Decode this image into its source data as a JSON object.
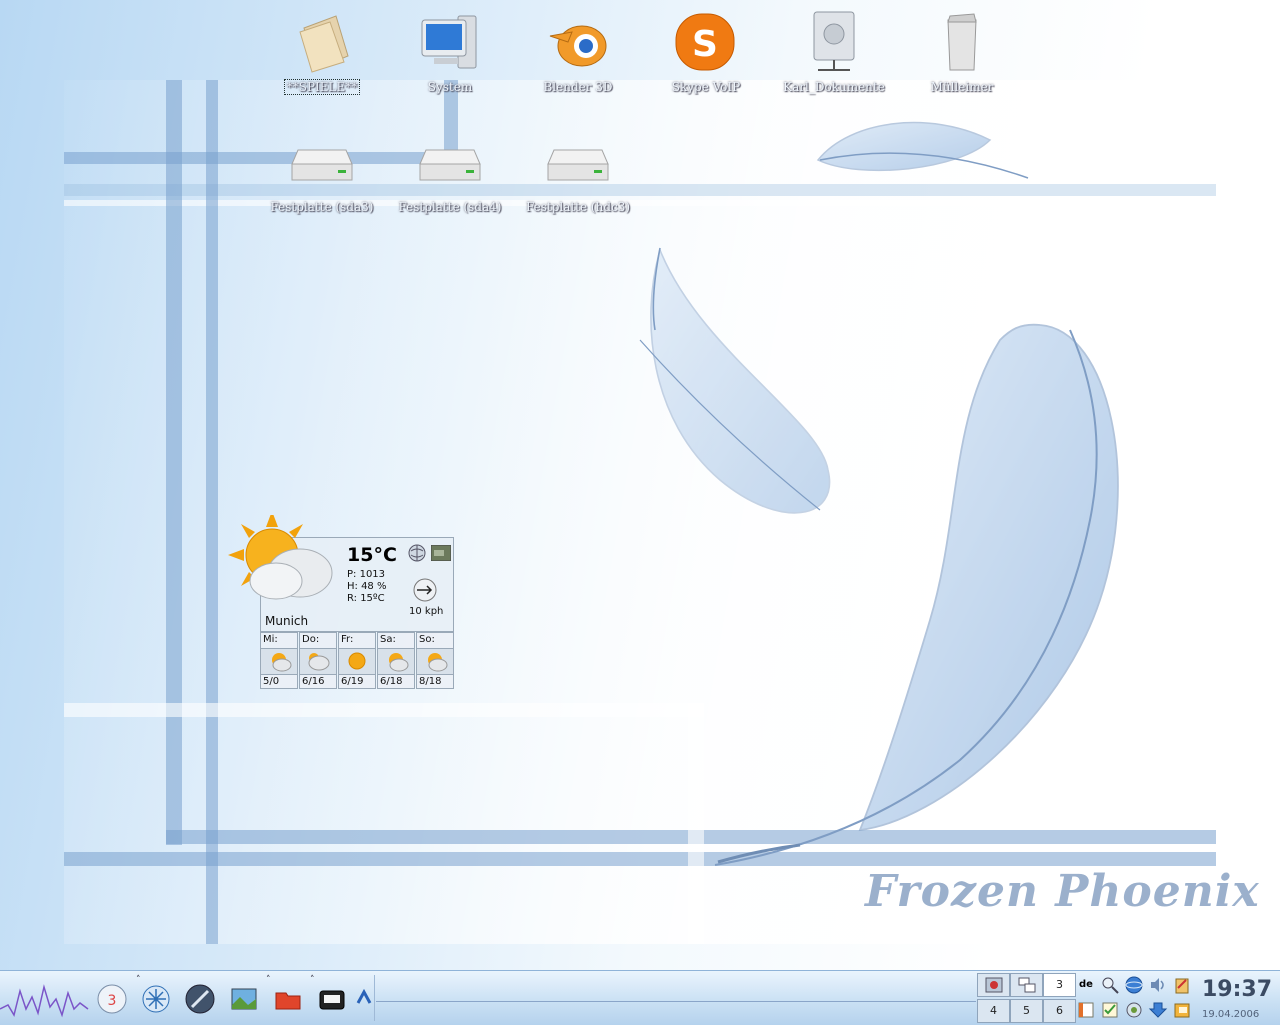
{
  "desktop": {
    "icons": [
      {
        "label": "**SPIELE**",
        "icon": "folder-icon",
        "selected": true
      },
      {
        "label": "System",
        "icon": "computer-icon"
      },
      {
        "label": "Blender 3D",
        "icon": "blender-icon"
      },
      {
        "label": "Skype VoIP",
        "icon": "skype-icon"
      },
      {
        "label": "Karl_Dokumente",
        "icon": "network-drive-icon"
      },
      {
        "label": "Mülleimer",
        "icon": "trash-icon"
      },
      {
        "label": "Festplatte (sda3)",
        "icon": "harddisk-icon"
      },
      {
        "label": "Festplatte (sda4)",
        "icon": "harddisk-icon"
      },
      {
        "label": "Festplatte (hdc3)",
        "icon": "harddisk-icon"
      }
    ],
    "brand_text": "Frozen Phoenix"
  },
  "weather": {
    "temperature": "15°C",
    "pressure": "P: 1013",
    "humidity": "H: 48 %",
    "real_feel": "R: 15ºC",
    "wind": "10 kph",
    "city": "Munich",
    "forecast": [
      {
        "day": "Mi:",
        "temps": "5/0",
        "icon": "partly-sunny-icon"
      },
      {
        "day": "Do:",
        "temps": "6/16",
        "icon": "cloudy-icon"
      },
      {
        "day": "Fr:",
        "temps": "6/19",
        "icon": "sunny-icon"
      },
      {
        "day": "Sa:",
        "temps": "6/18",
        "icon": "partly-sunny-icon"
      },
      {
        "day": "So:",
        "temps": "8/18",
        "icon": "partly-sunny-icon"
      }
    ]
  },
  "taskbar": {
    "pager": [
      "3",
      "4",
      "5",
      "6"
    ],
    "clock": "19:37",
    "date": "19.04.2006",
    "keyboard_layout": "de"
  },
  "colors": {
    "bar": "#7aa0cd",
    "taskbar_top": "#eaf4fd",
    "brand": "#9bb0cc"
  }
}
